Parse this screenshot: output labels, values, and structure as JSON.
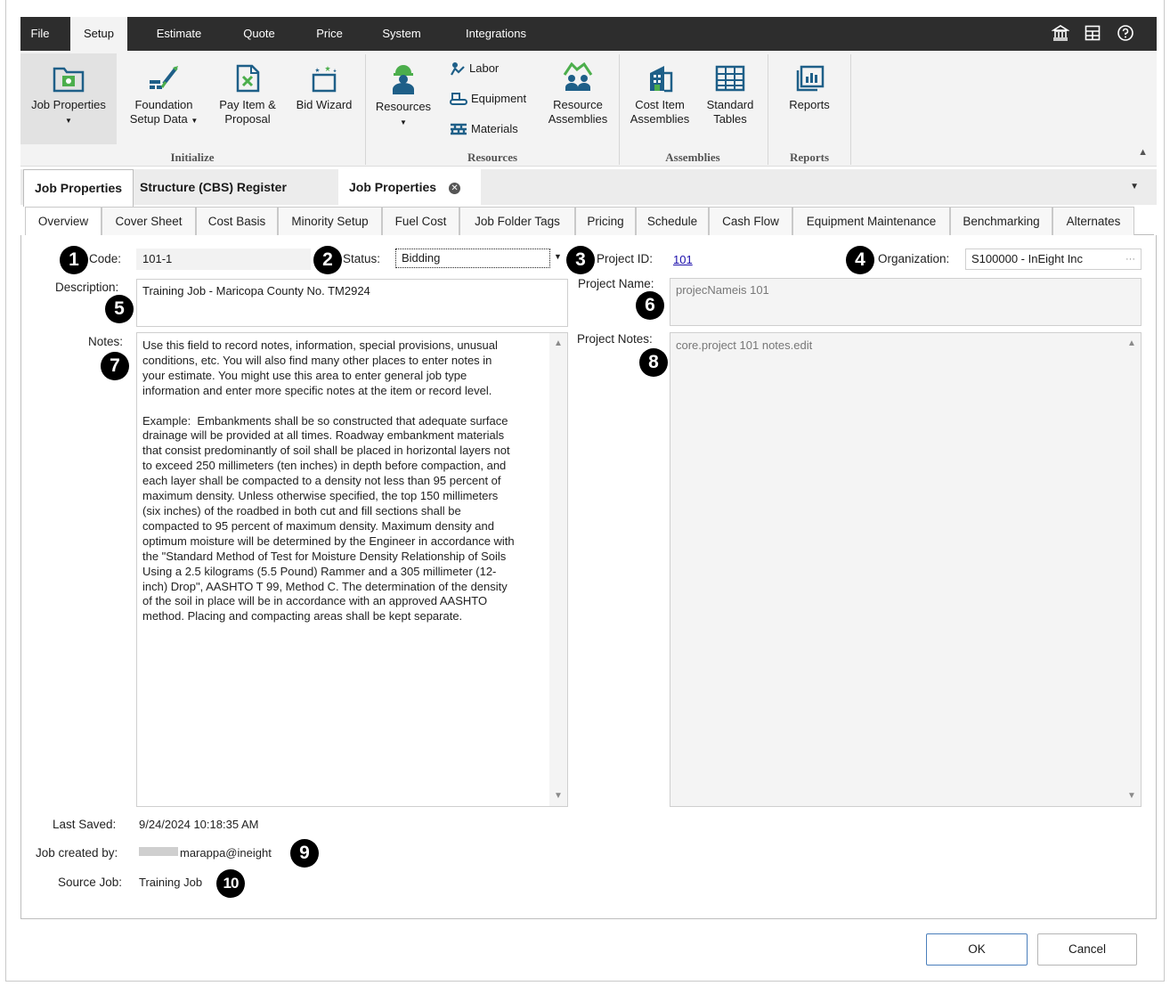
{
  "menu": {
    "items": [
      "File",
      "Setup",
      "Estimate",
      "Quote",
      "Price",
      "System",
      "Integrations"
    ],
    "active": "Setup",
    "right_icons": [
      "bank-icon",
      "grid-icon",
      "help-icon"
    ]
  },
  "ribbon": {
    "job_properties": "Job Properties",
    "foundation_1": "Foundation",
    "foundation_2": "Setup Data",
    "pay_item_1": "Pay Item &",
    "pay_item_2": "Proposal",
    "bid_wizard": "Bid Wizard",
    "resources": "Resources",
    "labor": "Labor",
    "equipment": "Equipment",
    "materials": "Materials",
    "resource_assemblies_1": "Resource",
    "resource_assemblies_2": "Assemblies",
    "cost_item_1": "Cost Item",
    "cost_item_2": "Assemblies",
    "standard_tables_1": "Standard",
    "standard_tables_2": "Tables",
    "reports": "Reports",
    "groups": {
      "initialize": "Initialize",
      "resources": "Resources",
      "assemblies": "Assemblies",
      "reports": "Reports"
    }
  },
  "doc_tabs": {
    "first": "Job Properties",
    "second": "Structure (CBS) Register",
    "third": "Job Properties"
  },
  "tabs": [
    "Overview",
    "Cover Sheet",
    "Cost Basis",
    "Minority Setup",
    "Fuel Cost",
    "Job Folder Tags",
    "Pricing",
    "Schedule",
    "Cash Flow",
    "Equipment Maintenance",
    "Benchmarking",
    "Alternates"
  ],
  "form": {
    "code_label": "Code:",
    "code_value": "101-1",
    "status_label": "Status:",
    "status_value": "Bidding",
    "project_id_label": "Project ID:",
    "project_id_value": "101",
    "organization_label": "Organization:",
    "organization_value": "S100000 - InEight Inc",
    "organization_btn": "···",
    "description_label": "Description:",
    "description_value": "Training Job - Maricopa County No. TM2924",
    "project_name_label": "Project Name:",
    "project_name_value": "projecNameis 101",
    "notes_label": "Notes:",
    "notes_value": "Use this field to record notes, information, special provisions, unusual\nconditions, etc. You will also find many other places to enter notes in\nyour estimate. You might use this area to enter general job type\ninformation and enter more specific notes at the item or record level.\n\nExample:  Embankments shall be so constructed that adequate surface\ndrainage will be provided at all times. Roadway embankment materials\nthat consist predominantly of soil shall be placed in horizontal layers not\nto exceed 250 millimeters (ten inches) in depth before compaction, and\neach layer shall be compacted to a density not less than 95 percent of\nmaximum density. Unless otherwise specified, the top 150 millimeters\n(six inches) of the roadbed in both cut and fill sections shall be\ncompacted to 95 percent of maximum density. Maximum density and\noptimum moisture will be determined by the Engineer in accordance with\nthe \"Standard Method of Test for Moisture Density Relationship of Soils\nUsing a 2.5 kilograms (5.5 Pound) Rammer and a 305 millimeter (12-\ninch) Drop\", AASHTO T 99, Method C. The determination of the density\nof the soil in place will be in accordance with an approved AASHTO\nmethod. Placing and compacting areas shall be kept separate.",
    "project_notes_label": "Project Notes:",
    "project_notes_value": "core.project 101 notes.edit",
    "last_saved_label": "Last Saved:",
    "last_saved_value": "9/24/2024 10:18:35 AM",
    "created_by_label": "Job created by:",
    "created_by_value": "marappa@ineight",
    "source_job_label": "Source Job:",
    "source_job_value": "Training Job"
  },
  "callouts": [
    "1",
    "2",
    "3",
    "4",
    "5",
    "6",
    "7",
    "8",
    "9",
    "10"
  ],
  "buttons": {
    "ok": "OK",
    "cancel": "Cancel"
  },
  "colors": {
    "menubar": "#2d2d2d",
    "ribbon": "#f3f3f3",
    "icon_blue": "#1e5f88",
    "icon_green": "#4cae4c",
    "link": "#1a0dab"
  }
}
